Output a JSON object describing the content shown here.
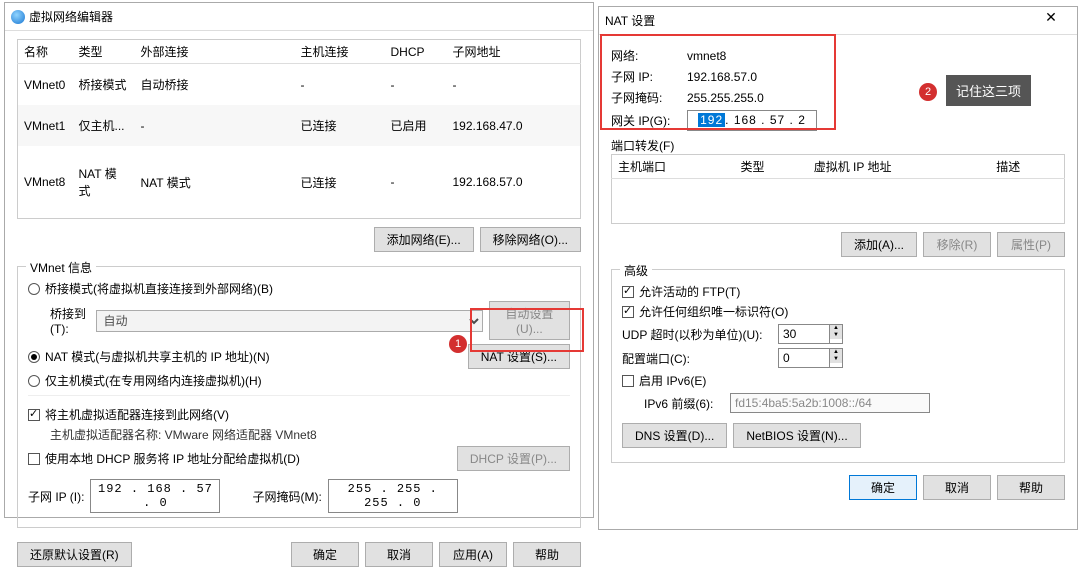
{
  "left": {
    "title": "虚拟网络编辑器",
    "cols": [
      "名称",
      "类型",
      "外部连接",
      "主机连接",
      "DHCP",
      "子网地址"
    ],
    "rows": [
      {
        "name": "VMnet0",
        "type": "桥接模式",
        "ext": "自动桥接",
        "host": "-",
        "dhcp": "-",
        "sub": "-"
      },
      {
        "name": "VMnet1",
        "type": "仅主机...",
        "ext": "-",
        "host": "已连接",
        "dhcp": "已启用",
        "sub": "192.168.47.0"
      },
      {
        "name": "VMnet8",
        "type": "NAT 模式",
        "ext": "NAT 模式",
        "host": "已连接",
        "dhcp": "-",
        "sub": "192.168.57.0"
      }
    ],
    "add_net": "添加网络(E)...",
    "remove_net": "移除网络(O)...",
    "group": "VMnet 信息",
    "opt_bridge": "桥接模式(将虚拟机直接连接到外部网络)(B)",
    "bridge_to_l": "桥接到(T):",
    "bridge_to_v": "自动",
    "auto_set": "自动设置(U)...",
    "opt_nat": "NAT 模式(与虚拟机共享主机的 IP 地址)(N)",
    "nat_set": "NAT 设置(S)...",
    "opt_host": "仅主机模式(在专用网络内连接虚拟机)(H)",
    "chk_adapter": "将主机虚拟适配器连接到此网络(V)",
    "adapter_name": "主机虚拟适配器名称: VMware 网络适配器 VMnet8",
    "chk_dhcp": "使用本地 DHCP 服务将 IP 地址分配给虚拟机(D)",
    "dhcp_set": "DHCP 设置(P)...",
    "subip_l": "子网 IP (I):",
    "subip_v": "192 . 168 . 57 . 0",
    "submask_l": "子网掩码(M):",
    "submask_v": "255 . 255 . 255 . 0",
    "restore": "还原默认设置(R)",
    "ok": "确定",
    "cancel": "取消",
    "apply": "应用(A)",
    "help": "帮助"
  },
  "right": {
    "title": "NAT 设置",
    "net_l": "网络:",
    "net_v": "vmnet8",
    "sip_l": "子网 IP:",
    "sip_v": "192.168.57.0",
    "smask_l": "子网掩码:",
    "smask_v": "255.255.255.0",
    "gw_l": "网关 IP(G):",
    "gw_oct1": "192",
    "gw_rest": ". 168 . 57 . 2",
    "pf": "端口转发(F)",
    "pf_cols": [
      "主机端口",
      "类型",
      "虚拟机 IP 地址",
      "描述"
    ],
    "add": "添加(A)...",
    "remove": "移除(R)",
    "props": "属性(P)",
    "adv": "高级",
    "chk_ftp": "允许活动的 FTP(T)",
    "chk_org": "允许任何组织唯一标识符(O)",
    "udp_l": "UDP 超时(以秒为单位)(U):",
    "udp_v": "30",
    "cfg_l": "配置端口(C):",
    "cfg_v": "0",
    "chk_ipv6": "启用 IPv6(E)",
    "ipv6_l": "IPv6 前缀(6):",
    "ipv6_v": "fd15:4ba5:5a2b:1008::/64",
    "dns": "DNS 设置(D)...",
    "netbios": "NetBIOS 设置(N)...",
    "ok": "确定",
    "cancel": "取消",
    "help": "帮助"
  },
  "annot": {
    "tip": "记住这三项"
  }
}
